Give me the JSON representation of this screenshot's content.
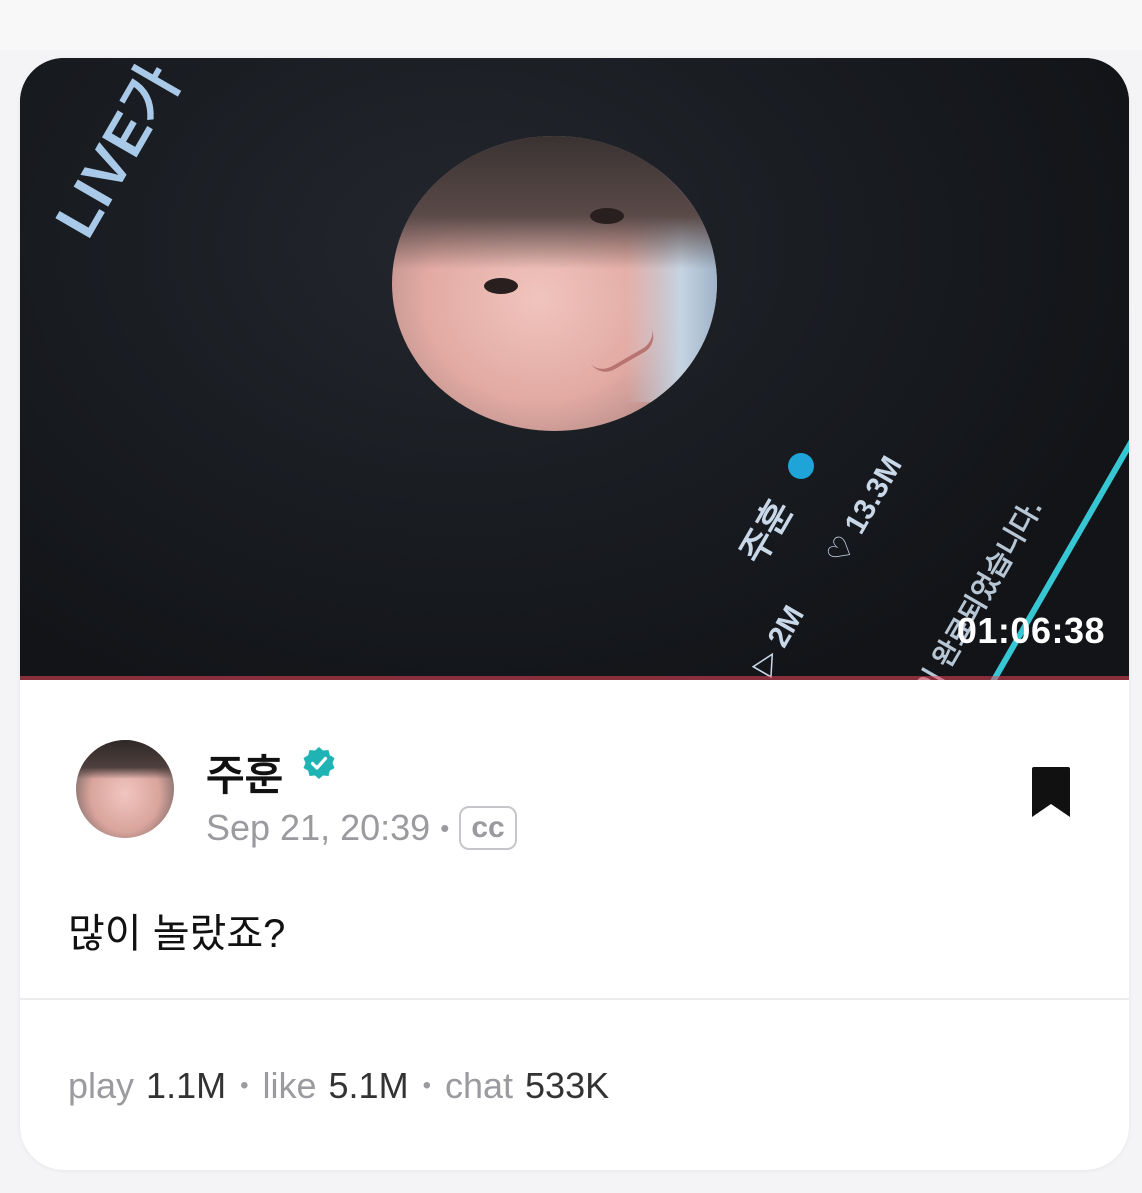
{
  "thumbnail": {
    "overlay_live_text": "LIVE가 종료되",
    "overlay_name": "주훈",
    "overlay_likes": "♡ 13.3M",
    "overlay_plays": "▷ 2M",
    "overlay_ended": "이 완료되었습니다.",
    "duration": "01:06:38"
  },
  "post": {
    "author": "주훈",
    "timestamp": "Sep 21, 20:39",
    "separator": "•",
    "cc_label": "cc",
    "text": "많이 놀랐죠?"
  },
  "stats": {
    "play_label": "play",
    "play_value": "1.1M",
    "like_label": "like",
    "like_value": "5.1M",
    "chat_label": "chat",
    "chat_value": "533K",
    "separator": "•"
  },
  "colors": {
    "verified": "#1fb3b3",
    "accent_teal": "#37c7d4"
  },
  "icons": {
    "verified": "verified-badge-icon",
    "bookmark": "bookmark-icon"
  }
}
